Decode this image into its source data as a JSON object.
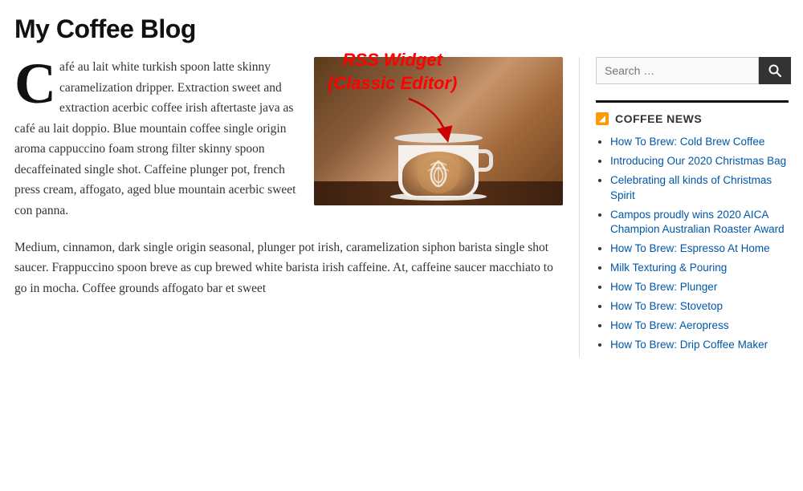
{
  "site": {
    "title": "My Coffee Blog"
  },
  "annotation": {
    "text": "RSS Widget\n(Classic Editor)",
    "display_line1": "RSS Widget",
    "display_line2": "(Classic Editor)"
  },
  "article": {
    "drop_cap": "C",
    "paragraph1": "afé au lait white turkish spoon latte skinny caramelization dripper. Extraction sweet and extraction acerbic coffee irish aftertaste java as café au lait doppio. Blue mountain coffee single origin aroma cappuccino foam strong filter skinny spoon decaffeinated single shot. Caffeine plunger pot, french press cream, affogato, aged blue mountain acerbic sweet con panna.",
    "paragraph2": "Medium, cinnamon, dark single origin seasonal, plunger pot irish, caramelization siphon barista single shot saucer. Frappuccino spoon breve as cup brewed white barista irish caffeine. At, caffeine saucer macchiato to go in mocha. Coffee grounds affogato bar et sweet"
  },
  "sidebar": {
    "search": {
      "placeholder": "Search …",
      "button_label": "Search"
    },
    "coffee_news": {
      "section_title": "COFFEE NEWS",
      "items": [
        {
          "label": "How To Brew: Cold Brew Coffee",
          "href": "#"
        },
        {
          "label": "Introducing Our 2020 Christmas Bag",
          "href": "#"
        },
        {
          "label": "Celebrating all kinds of Christmas Spirit",
          "href": "#"
        },
        {
          "label": "Campos proudly wins 2020 AICA Champion Australian Roaster Award",
          "href": "#"
        },
        {
          "label": "How To Brew: Espresso At Home",
          "href": "#"
        },
        {
          "label": "Milk Texturing & Pouring",
          "href": "#"
        },
        {
          "label": "How To Brew: Plunger",
          "href": "#"
        },
        {
          "label": "How To Brew: Stovetop",
          "href": "#"
        },
        {
          "label": "How To Brew: Aeropress",
          "href": "#"
        },
        {
          "label": "How To Brew: Drip Coffee Maker",
          "href": "#"
        }
      ]
    }
  }
}
